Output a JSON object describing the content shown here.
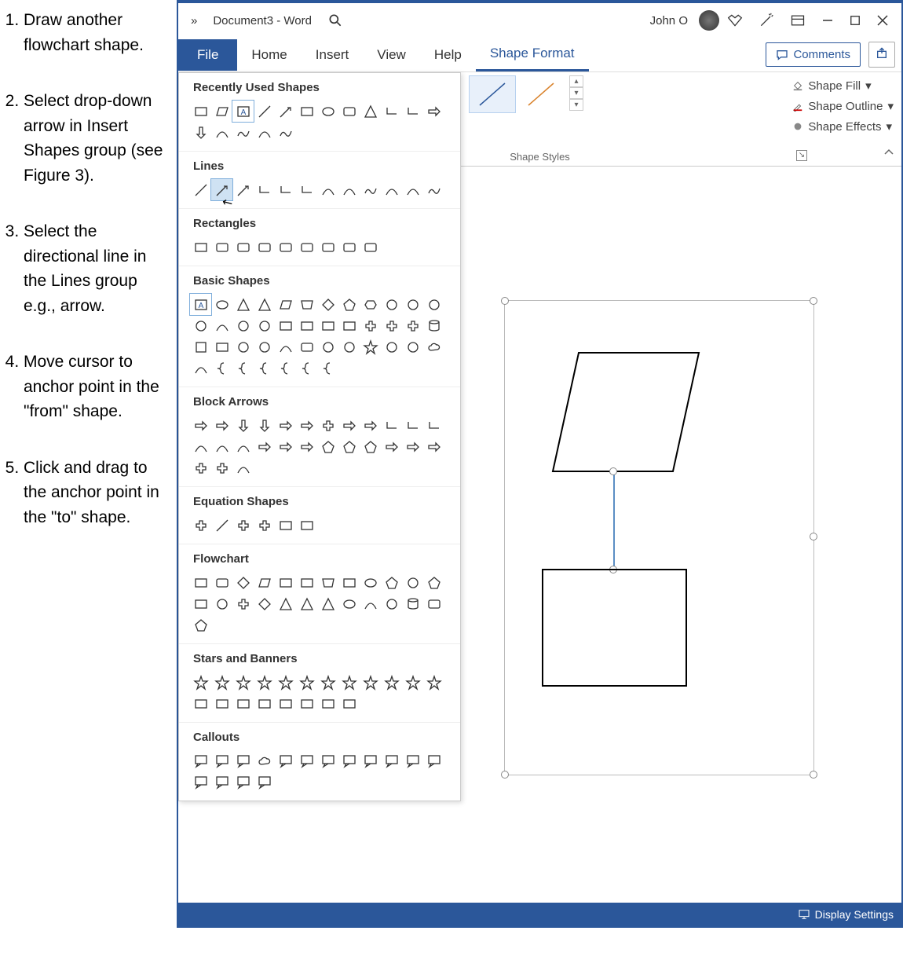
{
  "instructions": [
    "Draw another flowchart shape.",
    "Select drop-down arrow in Insert Shapes group (see Figure 3).",
    "Select the directional line in the Lines group e.g., arrow.",
    "Move cursor to anchor point in the \"from\" shape.",
    "Click and drag to the anchor point in the \"to\" shape."
  ],
  "titlebar": {
    "overflow": "»",
    "doc_title": "Document3 - Word",
    "user_name": "John O"
  },
  "tabs": {
    "file": "File",
    "home": "Home",
    "insert": "Insert",
    "view": "View",
    "help": "Help",
    "shape_format": "Shape Format"
  },
  "buttons": {
    "comments": "Comments"
  },
  "ribbon": {
    "shape_fill": "Shape Fill",
    "shape_outline": "Shape Outline",
    "shape_effects": "Shape Effects",
    "group_label": "Shape Styles"
  },
  "dropdown": {
    "recent": "Recently Used Shapes",
    "lines": "Lines",
    "rectangles": "Rectangles",
    "basic": "Basic Shapes",
    "block_arrows": "Block Arrows",
    "equation": "Equation Shapes",
    "flowchart": "Flowchart",
    "stars": "Stars and Banners",
    "callouts": "Callouts"
  },
  "statusbar": {
    "display_settings": "Display Settings"
  }
}
